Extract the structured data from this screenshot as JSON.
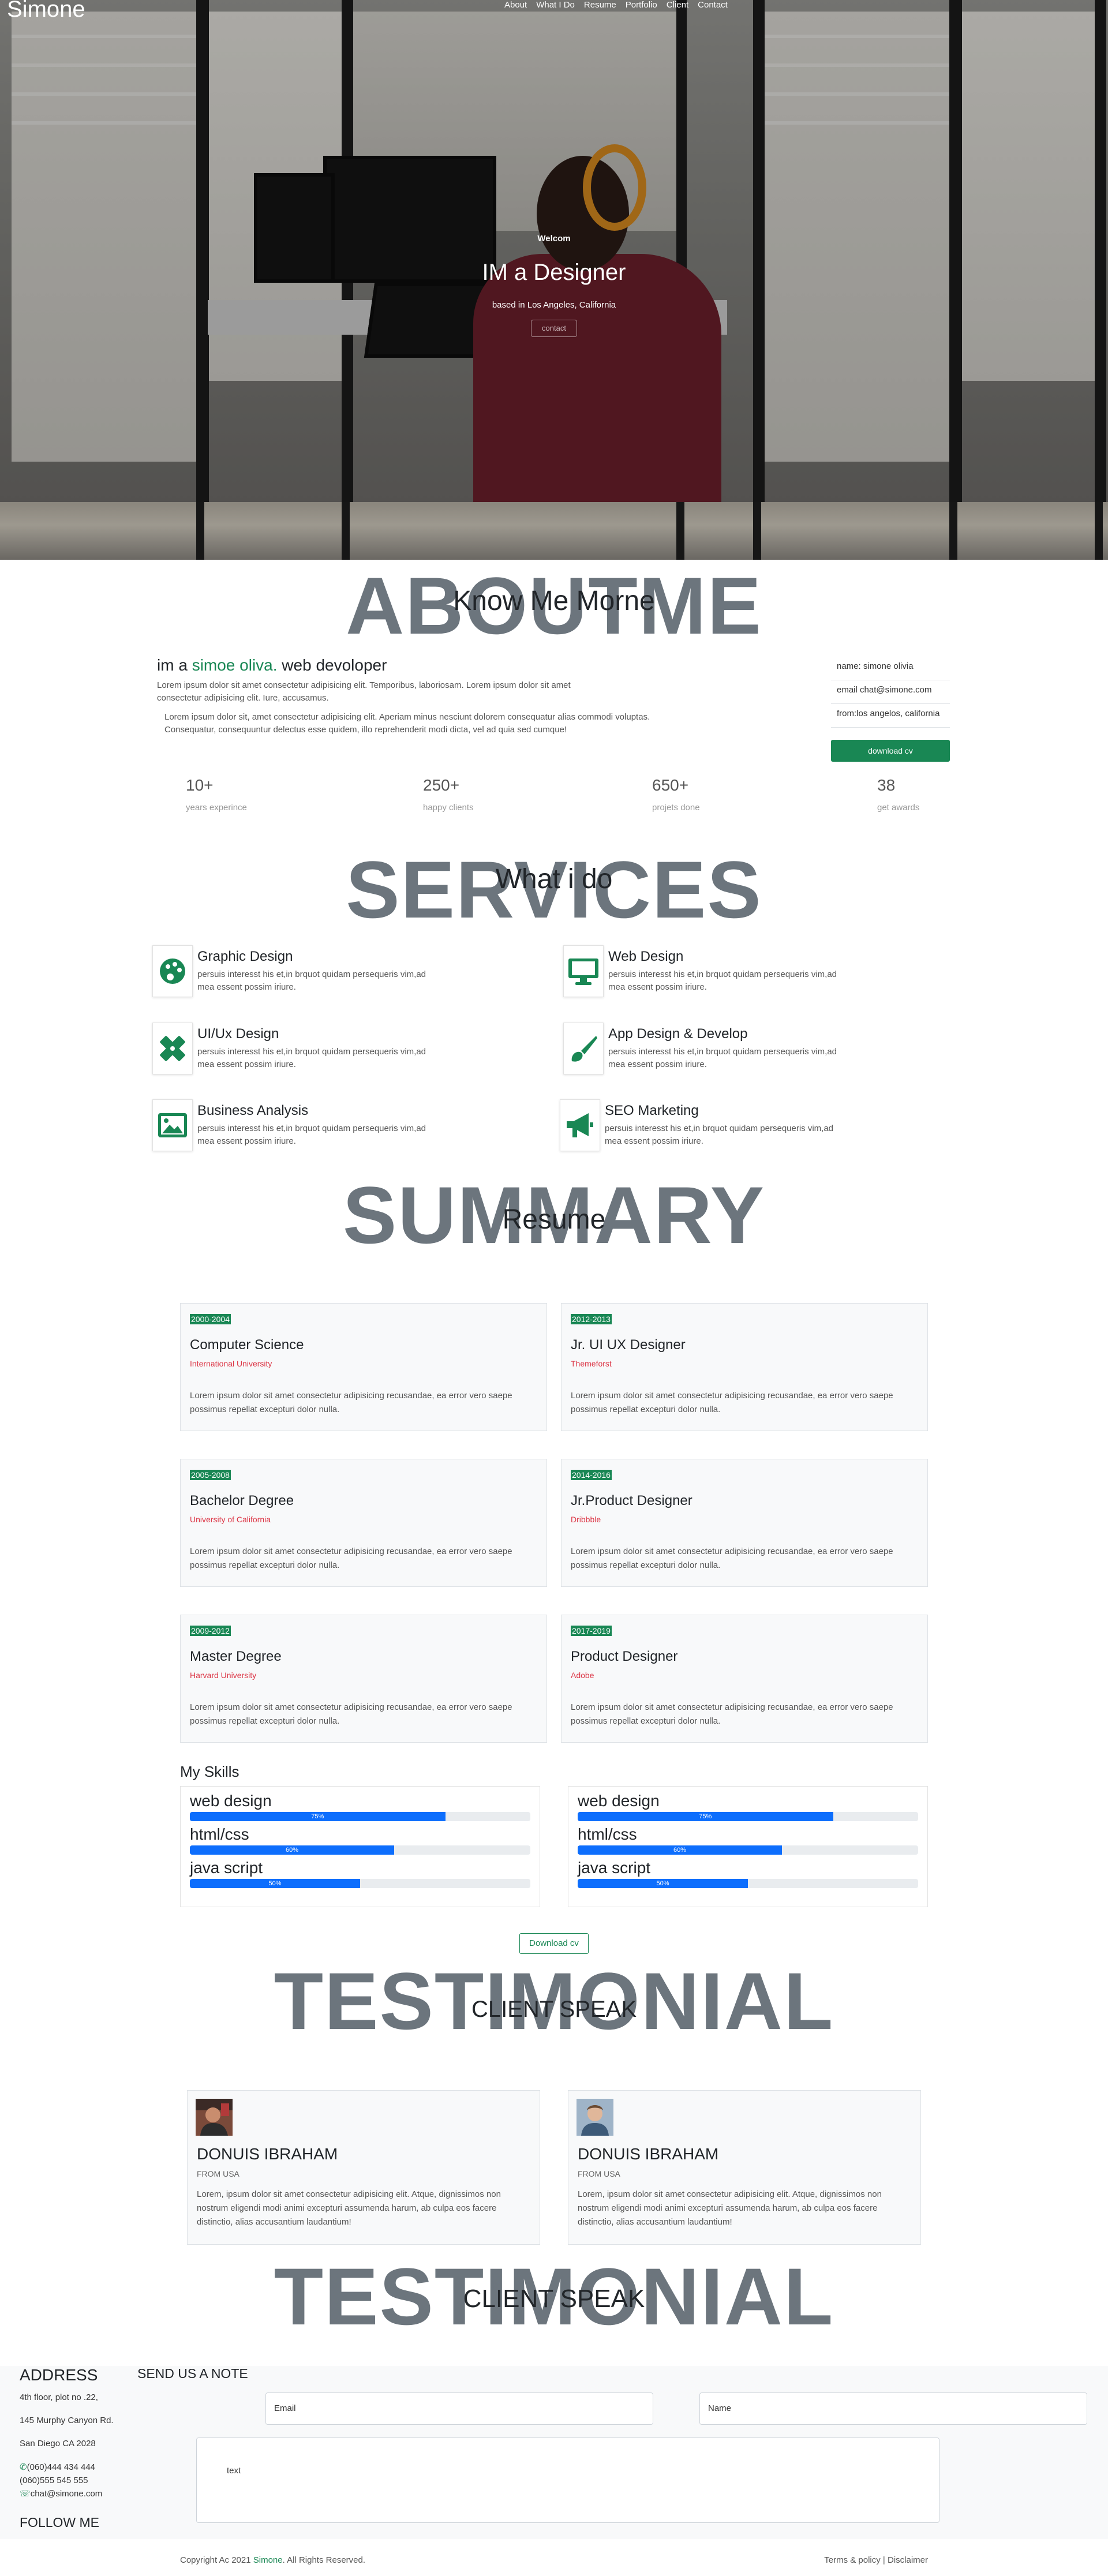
{
  "brand": "Simone",
  "nav": [
    "About",
    "What I Do",
    "Resume",
    "Portfolio",
    "Client",
    "Contact"
  ],
  "hero": {
    "welcome": "Welcom",
    "title": "IM a Designer",
    "subtitle": "based in Los Angeles, California",
    "button": "contact"
  },
  "about": {
    "big": "ABOUTME",
    "sub": "Know Me Morne",
    "heading_prefix": "im a ",
    "heading_name": "simoe oliva.",
    "heading_suffix": " web devoloper",
    "p1": "Lorem ipsum dolor sit amet consectetur adipisicing elit. Temporibus, laboriosam. Lorem ipsum dolor sit amet consectetur adipisicing elit. Iure, accusamus.",
    "p2": "Lorem ipsum dolor sit, amet consectetur adipisicing elit. Aperiam minus nesciunt dolorem consequatur alias commodi voluptas. Consequatur, consequuntur delectus esse quidem, illo reprehenderit modi dicta, vel ad quia sed cumque!",
    "info": [
      "name: simone olivia",
      "email chat@simone.com",
      "from:los angelos, california"
    ],
    "cv_button": "download cv",
    "stats": [
      {
        "num": "10+",
        "label": "years experince"
      },
      {
        "num": "250+",
        "label": "happy clients"
      },
      {
        "num": "650+",
        "label": "projets done"
      },
      {
        "num": "38",
        "label": "get awards"
      }
    ]
  },
  "services": {
    "big": "SERVICES",
    "sub": "What i do",
    "items": [
      {
        "title": "Graphic Design",
        "icon": "palette-icon",
        "desc": "persuis interesst his et,in brquot quidam persequeris vim,ad mea essent possim iriure."
      },
      {
        "title": "Web Design",
        "icon": "desktop-icon",
        "desc": "persuis interesst his et,in brquot quidam persequeris vim,ad mea essent possim iriure."
      },
      {
        "title": "UI/Ux Design",
        "icon": "pencil-ruler-icon",
        "desc": "persuis interesst his et,in brquot quidam persequeris vim,ad mea essent possim iriure."
      },
      {
        "title": "App Design & Develop",
        "icon": "paint-brush-icon",
        "desc": "persuis interesst his et,in brquot quidam persequeris vim,ad mea essent possim iriure."
      },
      {
        "title": "Business Analysis",
        "icon": "image-icon",
        "desc": "persuis interesst his et,in brquot quidam persequeris vim,ad mea essent possim iriure."
      },
      {
        "title": "SEO Marketing",
        "icon": "megaphone-icon",
        "desc": "persuis interesst his et,in brquot quidam persequeris vim,ad mea essent possim iriure."
      }
    ]
  },
  "resume": {
    "big": "SUMMARY",
    "sub": "Resume",
    "cards": [
      {
        "years": "2000-2004",
        "title": "Computer Science",
        "place": "International University",
        "desc": "Lorem ipsum dolor sit amet consectetur adipisicing recusandae, ea error vero saepe possimus repellat excepturi dolor nulla."
      },
      {
        "years": "2012-2013",
        "title": "Jr. UI UX Designer",
        "place": "Themeforst",
        "desc": "Lorem ipsum dolor sit amet consectetur adipisicing recusandae, ea error vero saepe possimus repellat excepturi dolor nulla."
      },
      {
        "years": "2005-2008",
        "title": "Bachelor Degree",
        "place": "University of California",
        "desc": "Lorem ipsum dolor sit amet consectetur adipisicing recusandae, ea error vero saepe possimus repellat excepturi dolor nulla."
      },
      {
        "years": "2014-2016",
        "title": "Jr.Product Designer",
        "place": "Dribbble",
        "desc": "Lorem ipsum dolor sit amet consectetur adipisicing recusandae, ea error vero saepe possimus repellat excepturi dolor nulla."
      },
      {
        "years": "2009-2012",
        "title": "Master Degree",
        "place": "Harvard University",
        "desc": "Lorem ipsum dolor sit amet consectetur adipisicing recusandae, ea error vero saepe possimus repellat excepturi dolor nulla."
      },
      {
        "years": "2017-2019",
        "title": "Product Designer",
        "place": "Adobe",
        "desc": "Lorem ipsum dolor sit amet consectetur adipisicing recusandae, ea error vero saepe possimus repellat excepturi dolor nulla."
      }
    ],
    "skills_title": "My Skills",
    "skills_left": [
      {
        "name": "web design",
        "percent": 75,
        "label": "75%"
      },
      {
        "name": "html/css",
        "percent": 60,
        "label": "60%"
      },
      {
        "name": "java script",
        "percent": 50,
        "label": "50%"
      }
    ],
    "skills_right": [
      {
        "name": "web design",
        "percent": 75,
        "label": "75%"
      },
      {
        "name": "html/css",
        "percent": 60,
        "label": "60%"
      },
      {
        "name": "java script",
        "percent": 50,
        "label": "50%"
      }
    ],
    "download_button": "Download cv"
  },
  "testimonials": {
    "big": "TESTIMONIAL",
    "sub": "CLIENT SPEAK",
    "cards": [
      {
        "name": "DONUIS IBRAHAM",
        "from": "FROM USA",
        "quote": "Lorem, ipsum dolor sit amet consectetur adipisicing elit. Atque, dignissimos non nostrum eligendi modi animi excepturi assumenda harum, ab culpa eos facere distinctio, alias accusantium laudantium!"
      },
      {
        "name": "DONUIS IBRAHAM",
        "from": "FROM USA",
        "quote": "Lorem, ipsum dolor sit amet consectetur adipisicing elit. Atque, dignissimos non nostrum eligendi modi animi excepturi assumenda harum, ab culpa eos facere distinctio, alias accusantium laudantium!"
      }
    ]
  },
  "contact": {
    "big": "TESTIMONIAL",
    "sub": "CLIENT SPEAK",
    "address_title": "ADDRESS",
    "address": [
      "4th floor, plot no .22,",
      "145 Murphy Canyon Rd.",
      "San Diego CA 2028"
    ],
    "phone1": "(060)444 434 444",
    "phone2": "(060)555 545 555",
    "email": "chat@simone.com",
    "follow": "FOLLOW ME",
    "note_title": "SEND US A NOTE",
    "email_placeholder": "Email",
    "name_placeholder": "Name",
    "text_placeholder": "text"
  },
  "footer": {
    "copy_prefix": "Copyright Ac 2021 ",
    "copy_name": "Simone",
    "copy_suffix": ". All Rights Reserved.",
    "terms": "Terms & policy | Disclaimer"
  },
  "colors": {
    "accent": "#198754",
    "progress": "#0d6efd",
    "muted_heading": "#6c757d",
    "place": "#dc3545"
  }
}
